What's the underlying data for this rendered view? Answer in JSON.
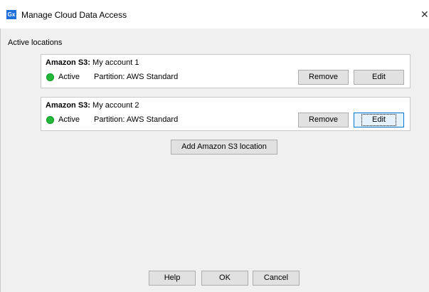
{
  "window": {
    "title": "Manage Cloud Data Access",
    "app_icon_text": "Gx",
    "close_glyph": "✕",
    "icons": {
      "app": "gx-app-icon",
      "close": "close-icon"
    }
  },
  "section": {
    "label": "Active locations"
  },
  "locations": [
    {
      "provider": "Amazon S3:",
      "name": "My account 1",
      "status": "Active",
      "status_color": "#22b93a",
      "partition": "Partition: AWS Standard",
      "remove_label": "Remove",
      "edit_label": "Edit"
    },
    {
      "provider": "Amazon S3:",
      "name": "My account 2",
      "status": "Active",
      "status_color": "#22b93a",
      "partition": "Partition: AWS Standard",
      "remove_label": "Remove",
      "edit_label": "Edit",
      "edit_focused": true
    }
  ],
  "add_location_label": "Add Amazon S3 location",
  "footer": {
    "help_label": "Help",
    "ok_label": "OK",
    "cancel_label": "Cancel"
  },
  "colors": {
    "accent": "#0078d7",
    "dialog_background": "#f0f0f0",
    "button_face": "#e1e1e1"
  }
}
